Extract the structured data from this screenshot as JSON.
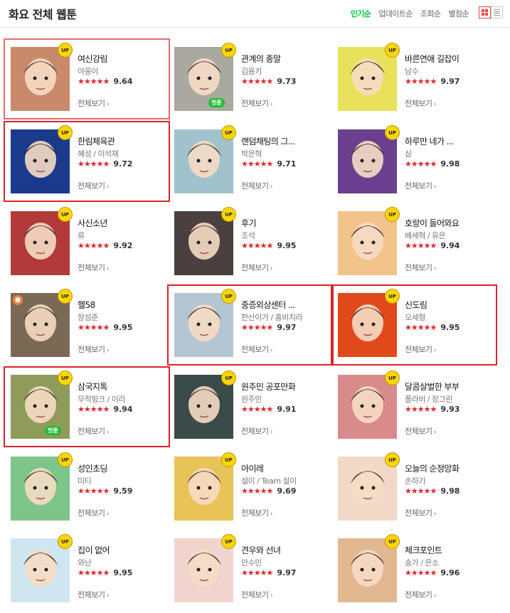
{
  "header": {
    "title": "화요 전체 웹툰",
    "sorts": [
      "인기순",
      "업데이트순",
      "조회순",
      "별점순"
    ],
    "active_sort": "인기순"
  },
  "labels": {
    "up": "UP",
    "cuttoon": "컷툰",
    "more": "전체보기",
    "stars": "★★★★★"
  },
  "webtoons": [
    {
      "title": "여신강림",
      "author": "야옹이",
      "score": "9.64",
      "up": true,
      "cuttoon": false,
      "person": false,
      "thumb": "#c98a6c"
    },
    {
      "title": "관계의 종말",
      "author": "김용키",
      "score": "9.73",
      "up": true,
      "cuttoon": true,
      "person": false,
      "thumb": "#a9a9a0"
    },
    {
      "title": "바른연애 길잡이",
      "author": "남수",
      "score": "9.97",
      "up": true,
      "cuttoon": false,
      "person": false,
      "thumb": "#e8e25a"
    },
    {
      "title": "한림체육관",
      "author": "혜성 / 이석재",
      "score": "9.72",
      "up": true,
      "cuttoon": false,
      "person": false,
      "thumb": "#1a3a8c"
    },
    {
      "title": "랜덤채팅의 그...",
      "author": "박은혁",
      "score": "9.71",
      "up": true,
      "cuttoon": false,
      "person": false,
      "thumb": "#9fc2cc"
    },
    {
      "title": "하루만 네가 ...",
      "author": "삼",
      "score": "9.98",
      "up": true,
      "cuttoon": false,
      "person": false,
      "thumb": "#6a3f8e"
    },
    {
      "title": "사신소년",
      "author": "류",
      "score": "9.92",
      "up": true,
      "cuttoon": false,
      "person": false,
      "thumb": "#b33a3a"
    },
    {
      "title": "후기",
      "author": "조석",
      "score": "9.95",
      "up": true,
      "cuttoon": false,
      "person": false,
      "thumb": "#4a4040"
    },
    {
      "title": "호랑이 들어와요",
      "author": "배세혁 / 유은",
      "score": "9.94",
      "up": true,
      "cuttoon": false,
      "person": false,
      "thumb": "#f2c48c"
    },
    {
      "title": "헬58",
      "author": "장성준",
      "score": "9.95",
      "up": true,
      "cuttoon": false,
      "person": true,
      "thumb": "#7a6a55"
    },
    {
      "title": "중증외상센터 ...",
      "author": "한산이가 / 홍비치라",
      "score": "9.97",
      "up": true,
      "cuttoon": false,
      "person": false,
      "thumb": "#b5c6d3"
    },
    {
      "title": "신도림",
      "author": "오세형",
      "score": "9.95",
      "up": true,
      "cuttoon": false,
      "person": false,
      "thumb": "#e04a1a"
    },
    {
      "title": "삼국지톡",
      "author": "무적핑크 / 이리",
      "score": "9.94",
      "up": true,
      "cuttoon": true,
      "person": false,
      "thumb": "#8e9b5a"
    },
    {
      "title": "원주민 공포만화",
      "author": "원주민",
      "score": "9.91",
      "up": true,
      "cuttoon": false,
      "person": false,
      "thumb": "#3a4a48"
    },
    {
      "title": "달콤살벌한 부부",
      "author": "플라비 / 장그린",
      "score": "9.93",
      "up": true,
      "cuttoon": false,
      "person": false,
      "thumb": "#d98a8a"
    },
    {
      "title": "성인초딩",
      "author": "미티",
      "score": "9.59",
      "up": true,
      "cuttoon": false,
      "person": false,
      "thumb": "#7ec58a"
    },
    {
      "title": "아이레",
      "author": "설이 / Team 설이",
      "score": "9.69",
      "up": true,
      "cuttoon": false,
      "person": false,
      "thumb": "#e8c458"
    },
    {
      "title": "오늘의 순정망화",
      "author": "손하기",
      "score": "9.98",
      "up": true,
      "cuttoon": false,
      "person": false,
      "thumb": "#f1d9c6"
    },
    {
      "title": "집이 없어",
      "author": "와난",
      "score": "9.95",
      "up": true,
      "cuttoon": false,
      "person": false,
      "thumb": "#cfe6f0"
    },
    {
      "title": "견우와 선녀",
      "author": "안수민",
      "score": "9.97",
      "up": true,
      "cuttoon": false,
      "person": false,
      "thumb": "#f2d4cf"
    },
    {
      "title": "체크포인트",
      "author": "송가 / 은소",
      "score": "9.96",
      "up": true,
      "cuttoon": false,
      "person": false,
      "thumb": "#e2b890"
    }
  ]
}
